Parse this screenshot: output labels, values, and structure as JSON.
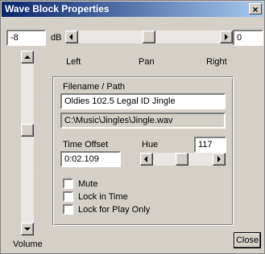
{
  "window": {
    "title": "Wave Block Properties",
    "close_glyph": "×"
  },
  "volume": {
    "db_value": "-8",
    "db_unit": "dB",
    "label": "Volume"
  },
  "pan": {
    "right_value": "0",
    "left_label": "Left",
    "center_label": "Pan",
    "right_label": "Right"
  },
  "file": {
    "group_label": "Filename / Path",
    "name": "Oldies 102.5 Legal ID Jingle",
    "path": "C:\\Music\\Jingles\\Jingle.wav"
  },
  "time_offset": {
    "label": "Time Offset",
    "value": "0:02.109"
  },
  "hue": {
    "label": "Hue",
    "value": "117"
  },
  "options": {
    "mute": "Mute",
    "lock_in_time": "Lock in Time",
    "lock_for_play_only": "Lock for Play Only"
  },
  "buttons": {
    "close": "Close"
  },
  "icons": {
    "arrow_left": "arrow-left-icon",
    "arrow_right": "arrow-right-icon",
    "arrow_up": "arrow-up-icon",
    "arrow_down": "arrow-down-icon"
  },
  "colors": {
    "titlebar_start": "#0a246a",
    "titlebar_end": "#a6caf0",
    "face": "#d4d0c8"
  }
}
